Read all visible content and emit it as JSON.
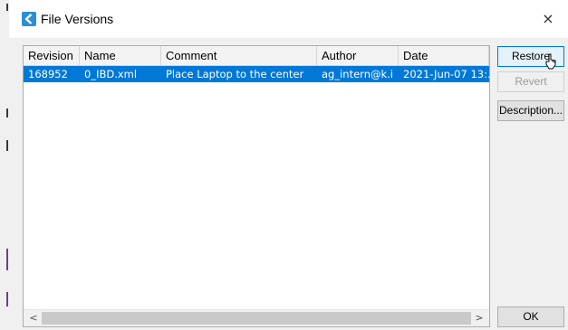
{
  "window": {
    "title": "File Versions",
    "close_symbol": "×",
    "app_icon": "app-logo-icon"
  },
  "table": {
    "columns": [
      "Revision",
      "Name",
      "Comment",
      "Author",
      "Date"
    ],
    "rows": [
      {
        "revision": "168952",
        "name": "0_IBD.xml",
        "comment": "Place Laptop to the center",
        "author": "ag_intern@k.i",
        "date": "2021-Jun-07 13:.."
      }
    ],
    "selected_row": 0
  },
  "buttons": {
    "restore": "Restore",
    "revert": "Revert",
    "description": "Description...",
    "ok": "OK"
  },
  "scrollbar": {
    "left_symbol": "<",
    "right_symbol": ">"
  },
  "colors": {
    "selection": "#0078d7",
    "dialog_bg": "#f0f0f0"
  }
}
